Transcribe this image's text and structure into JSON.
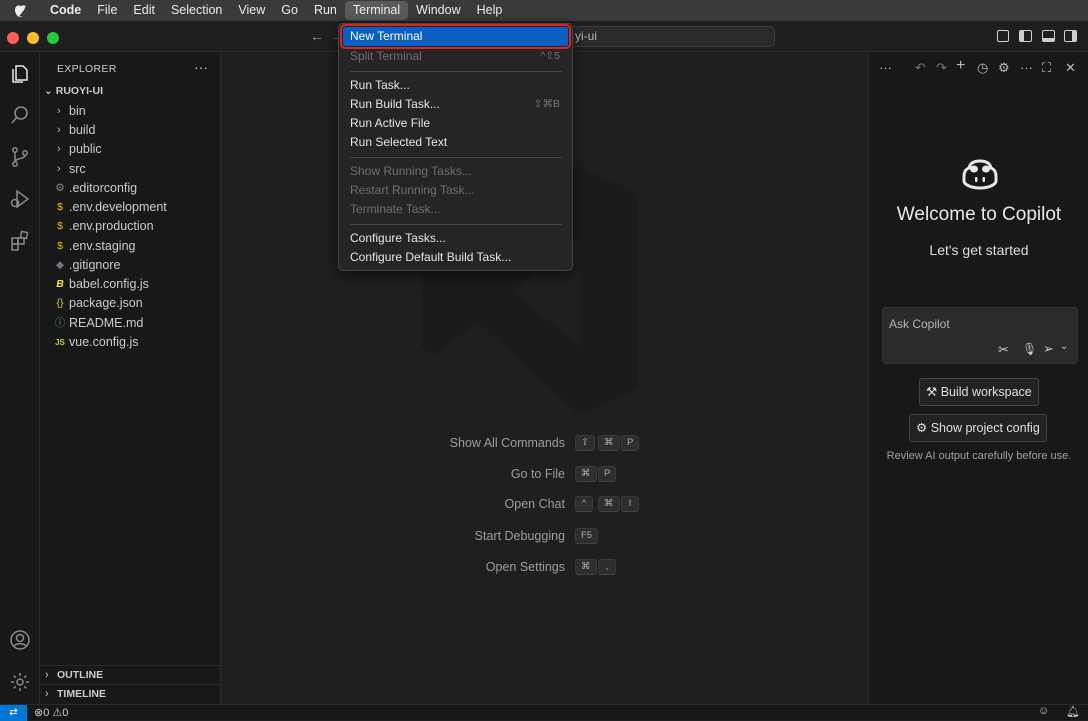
{
  "menubar": {
    "app": "Code",
    "items": [
      "File",
      "Edit",
      "Selection",
      "View",
      "Go",
      "Run",
      "Terminal",
      "Window",
      "Help"
    ],
    "active": "Terminal"
  },
  "titlebar": {
    "command_center": "yi-ui"
  },
  "explorer": {
    "header": "EXPLORER",
    "root": "RUOYI-UI",
    "folders": [
      "bin",
      "build",
      "public",
      "src"
    ],
    "files": [
      {
        "name": ".editorconfig",
        "icon": "gear-icon",
        "color": "#8c8c8c"
      },
      {
        "name": ".env.development",
        "icon": "dollar-icon",
        "color": "#e5c100"
      },
      {
        "name": ".env.production",
        "icon": "dollar-icon",
        "color": "#e5c100"
      },
      {
        "name": ".env.staging",
        "icon": "dollar-icon",
        "color": "#e5c100"
      },
      {
        "name": ".gitignore",
        "icon": "diamond-icon",
        "color": "#6c7a89"
      },
      {
        "name": "babel.config.js",
        "icon": "babel-icon",
        "color": "#f5da55"
      },
      {
        "name": "package.json",
        "icon": "braces-icon",
        "color": "#cbcb41"
      },
      {
        "name": "README.md",
        "icon": "info-icon",
        "color": "#519aba"
      },
      {
        "name": "vue.config.js",
        "icon": "js-icon",
        "color": "#cbcb41"
      }
    ],
    "outline": "OUTLINE",
    "timeline": "TIMELINE"
  },
  "terminal_menu": {
    "items": [
      {
        "label": "New Terminal",
        "shortcut": "",
        "disabled": false,
        "selected": true
      },
      {
        "label": "Split Terminal",
        "shortcut": "^⇧5",
        "disabled": true,
        "selected": false
      },
      {
        "label": "Run Task...",
        "shortcut": "",
        "disabled": false,
        "selected": false
      },
      {
        "label": "Run Build Task...",
        "shortcut": "⇧⌘B",
        "disabled": false,
        "selected": false
      },
      {
        "label": "Run Active File",
        "shortcut": "",
        "disabled": false,
        "selected": false
      },
      {
        "label": "Run Selected Text",
        "shortcut": "",
        "disabled": false,
        "selected": false
      },
      {
        "label": "Show Running Tasks...",
        "shortcut": "",
        "disabled": true,
        "selected": false
      },
      {
        "label": "Restart Running Task...",
        "shortcut": "",
        "disabled": true,
        "selected": false
      },
      {
        "label": "Terminate Task...",
        "shortcut": "",
        "disabled": true,
        "selected": false
      },
      {
        "label": "Configure Tasks...",
        "shortcut": "",
        "disabled": false,
        "selected": false
      },
      {
        "label": "Configure Default Build Task...",
        "shortcut": "",
        "disabled": false,
        "selected": false
      }
    ]
  },
  "editor_hints": [
    {
      "label": "Show All Commands",
      "keys": [
        "⇧",
        "⌘",
        "P"
      ]
    },
    {
      "label": "Go to File",
      "keys": [
        "⌘",
        "P"
      ]
    },
    {
      "label": "Open Chat",
      "keys": [
        "^",
        "⌘",
        "I"
      ]
    },
    {
      "label": "Start Debugging",
      "keys": [
        "F5"
      ]
    },
    {
      "label": "Open Settings",
      "keys": [
        "⌘",
        ","
      ]
    }
  ],
  "copilot": {
    "title": "Welcome to Copilot",
    "subtitle": "Let's get started",
    "input_placeholder": "Ask Copilot",
    "build_button": "Build workspace",
    "config_button": "Show project config",
    "review_note": "Review AI output carefully before use."
  },
  "statusbar": {
    "errors": "0",
    "warnings": "0"
  },
  "colors": {
    "accent": "#0078d4",
    "selection": "#0a5fc2",
    "highlight_box": "#e02222"
  }
}
